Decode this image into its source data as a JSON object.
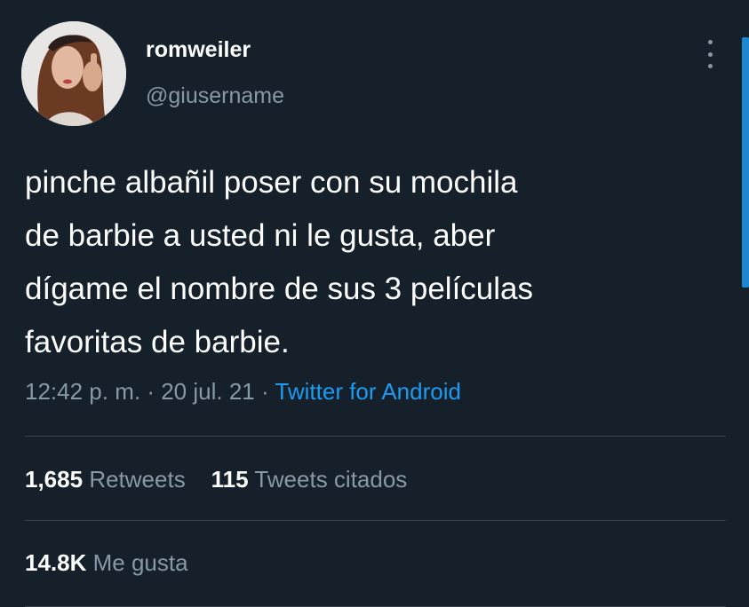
{
  "user": {
    "display_name": "romweiler",
    "handle": "@giusername"
  },
  "tweet": {
    "lines": [
      "pinche albañil poser con su mochila",
      "de barbie a usted ni le gusta, aber",
      "dígame el nombre de sus 3 películas",
      "favoritas de barbie."
    ],
    "time": "12:42 p. m.",
    "separator": "·",
    "date": "20 jul. 21",
    "source": "Twitter for Android"
  },
  "stats": {
    "retweets_count": "1,685",
    "retweets_label": "Retweets",
    "quotes_count": "115",
    "quotes_label": "Tweets citados",
    "likes_count": "14.8K",
    "likes_label": "Me gusta"
  },
  "icons": {
    "more": "more-vertical-icon"
  },
  "colors": {
    "background": "#15202b",
    "text": "#ffffff",
    "secondary": "#8899a6",
    "accent": "#1d9bf0",
    "divider": "#38444d"
  }
}
